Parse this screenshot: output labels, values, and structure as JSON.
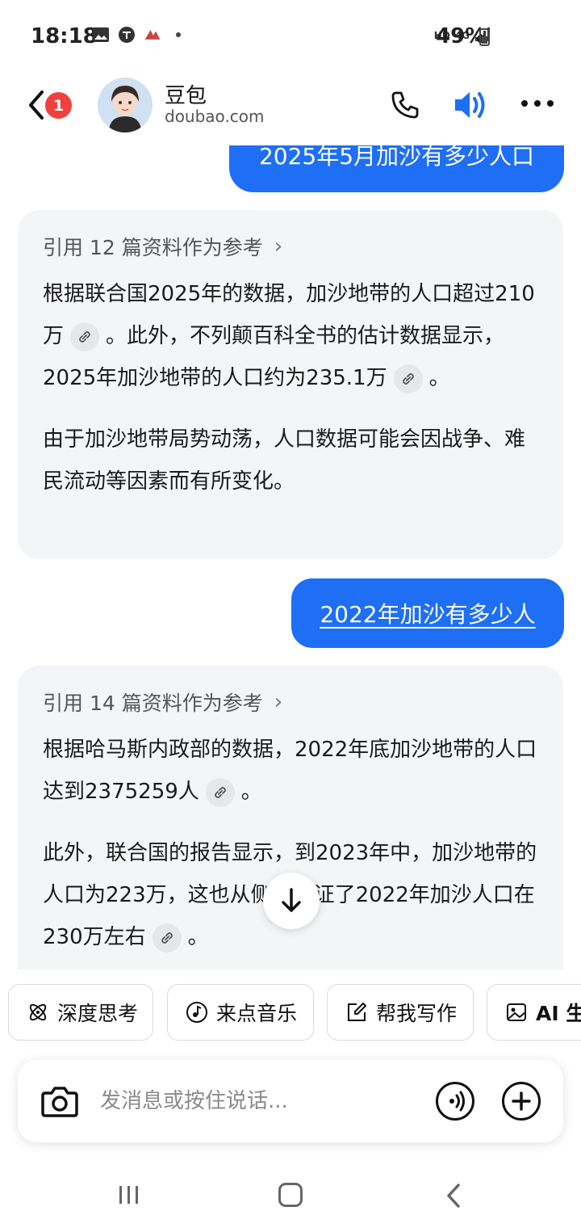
{
  "status_bar": {
    "time": "18:18",
    "network": "HD",
    "signal": "4G",
    "battery": "49%"
  },
  "header": {
    "back_badge": "1",
    "bot_name": "豆包",
    "bot_domain": "doubao.com"
  },
  "chat": {
    "user_msg_1": "2025年5月加沙有多少人口",
    "reply_1": {
      "ref": "引用 12 篇资料作为参考",
      "p1_a": "根据联合国2025年的数据，加沙地带的人口超过210万",
      "p1_b": "。此外，不列颠百科全书的估计数据显示，2025年加沙地带的人口约为235.1万",
      "p1_c": "。",
      "p2": "由于加沙地带局势动荡，人口数据可能会因战争、难民流动等因素而有所变化。"
    },
    "user_msg_2": "2022年加沙有多少人",
    "reply_2": {
      "ref": "引用 14 篇资料作为参考",
      "p1_a": "根据哈马斯内政部的数据，2022年底加沙地带的人口达到2375259人",
      "p1_b": "。",
      "p2_a": "此外，联合国的报告显示，到2023年中，加沙地带的人口为223万，这也从侧面印证了2022年加沙人口在230万左右",
      "p2_b": "。"
    }
  },
  "quick_actions": [
    {
      "label": "深度思考",
      "icon": "atom-icon"
    },
    {
      "label": "来点音乐",
      "icon": "music-icon"
    },
    {
      "label": "帮我写作",
      "icon": "edit-icon"
    },
    {
      "label": "AI 生",
      "icon": "image-icon"
    }
  ],
  "input": {
    "placeholder": "发消息或按住说话..."
  },
  "colors": {
    "accent": "#1e6ff5",
    "badge": "#f0413e",
    "bubble_bg": "#f4f5f7"
  }
}
